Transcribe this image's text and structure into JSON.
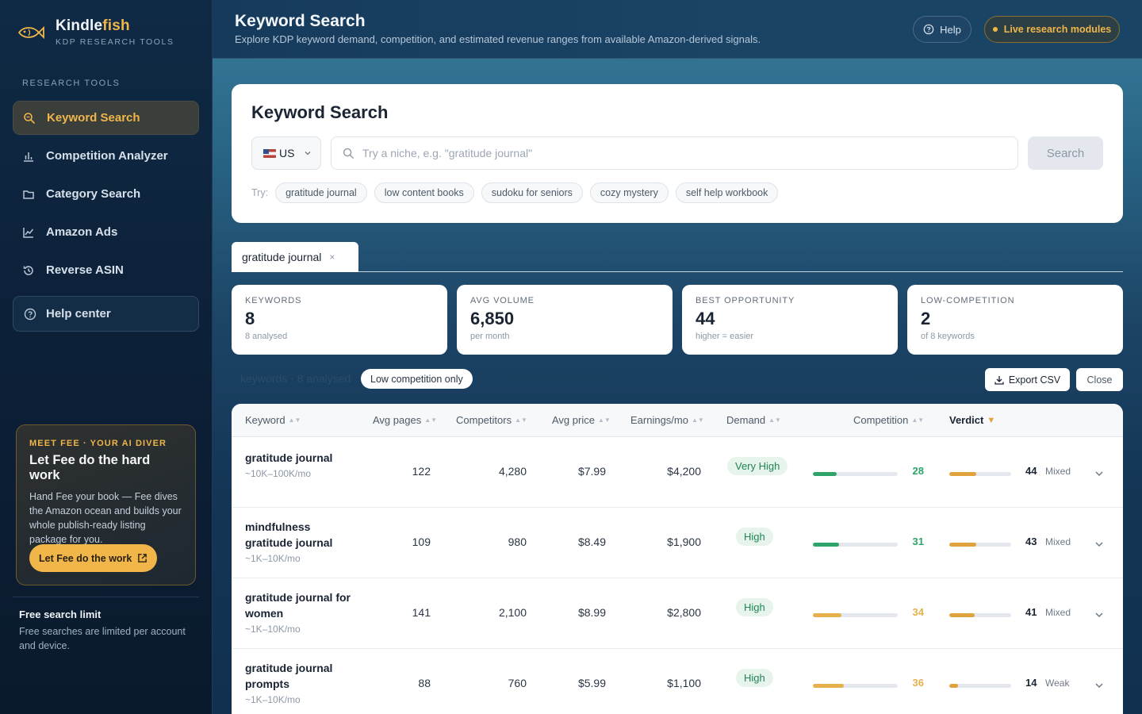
{
  "brand": {
    "name_main": "Kindle",
    "name_accent": "fish",
    "subtitle": "KDP RESEARCH TOOLS"
  },
  "sidebar": {
    "section_label": "RESEARCH TOOLS",
    "items": [
      {
        "label": "Keyword Search",
        "icon": "search-icon",
        "active": true
      },
      {
        "label": "Competition Analyzer",
        "icon": "bar-chart-icon"
      },
      {
        "label": "Category Search",
        "icon": "folder-icon"
      },
      {
        "label": "Amazon Ads",
        "icon": "line-chart-icon"
      },
      {
        "label": "Reverse ASIN",
        "icon": "history-icon"
      }
    ],
    "help_center": "Help center",
    "fee_card": {
      "kicker": "MEET FEE · YOUR AI DIVER",
      "title": "Let Fee do the hard work",
      "text": "Hand Fee your book — Fee dives the Amazon ocean and builds your whole publish-ready listing package for you.",
      "button": "Let Fee do the work"
    },
    "limit": {
      "title": "Free search limit",
      "text": "Free searches are limited per account and device."
    }
  },
  "header": {
    "title": "Keyword Search",
    "subtitle": "Explore KDP keyword demand, competition, and estimated revenue ranges from available Amazon-derived signals.",
    "help": "Help",
    "live": "Live research modules"
  },
  "search": {
    "title": "Keyword Search",
    "country": "US",
    "placeholder": "Try a niche, e.g. \"gratitude journal\"",
    "button": "Search",
    "try_label": "Try:",
    "suggestions": [
      "gratitude journal",
      "low content books",
      "sudoku for seniors",
      "cozy mystery",
      "self help workbook"
    ]
  },
  "tab": {
    "label": "gratitude journal",
    "close": "×"
  },
  "stats": [
    {
      "label": "KEYWORDS",
      "value": "8",
      "sub": "8 analysed"
    },
    {
      "label": "AVG VOLUME",
      "value": "6,850",
      "sub": "per month"
    },
    {
      "label": "BEST OPPORTUNITY",
      "value": "44",
      "sub": "higher = easier"
    },
    {
      "label": "LOW-COMPETITION",
      "value": "2",
      "sub": "of 8 keywords"
    }
  ],
  "toolbar": {
    "summary": "keywords · 8 analysed",
    "low_competition": "Low competition only",
    "export": "Export CSV",
    "close": "Close"
  },
  "table": {
    "headers": {
      "keyword": "Keyword",
      "pages": "Avg pages",
      "competitors": "Competitors",
      "price": "Avg price",
      "earnings": "Earnings/mo",
      "demand": "Demand",
      "competition": "Competition",
      "verdict": "Verdict"
    },
    "rows": [
      {
        "keyword": "gratitude journal",
        "range": "~10K–100K/mo",
        "pages": "122",
        "competitors": "4,280",
        "price": "$7.99",
        "earnings": "$4,200",
        "demand": "Very High",
        "competition": 28,
        "competition_color": "#2ea36a",
        "verdict_score": "44",
        "verdict_label": "Mixed"
      },
      {
        "keyword": "mindfulness gratitude journal",
        "range": "~1K–10K/mo",
        "pages": "109",
        "competitors": "980",
        "price": "$8.49",
        "earnings": "$1,900",
        "demand": "High",
        "competition": 31,
        "competition_color": "#2ea36a",
        "verdict_score": "43",
        "verdict_label": "Mixed"
      },
      {
        "keyword": "gratitude journal for women",
        "range": "~1K–10K/mo",
        "pages": "141",
        "competitors": "2,100",
        "price": "$8.99",
        "earnings": "$2,800",
        "demand": "High",
        "competition": 34,
        "competition_color": "#e6b04a",
        "verdict_score": "41",
        "verdict_label": "Mixed"
      },
      {
        "keyword": "gratitude journal prompts",
        "range": "~1K–10K/mo",
        "pages": "88",
        "competitors": "760",
        "price": "$5.99",
        "earnings": "$1,100",
        "demand": "High",
        "competition": 36,
        "competition_color": "#e6b04a",
        "verdict_score": "14",
        "verdict_label": "Weak"
      }
    ]
  },
  "colors": {
    "accent": "#f0b64a",
    "sidebar_bg": "#0f2a45",
    "green": "#2ea36a",
    "amber": "#e6b04a"
  }
}
